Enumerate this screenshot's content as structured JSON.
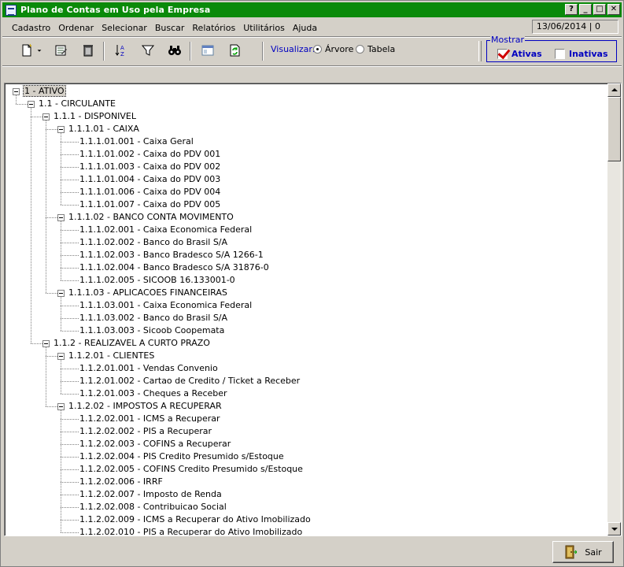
{
  "window": {
    "title": "Plano de Contas em Uso pela Empresa",
    "controls": [
      "?",
      "_",
      "□",
      "✕"
    ]
  },
  "menu": {
    "items": [
      "Cadastro",
      "Ordenar",
      "Selecionar",
      "Buscar",
      "Relatórios",
      "Utilitários",
      "Ajuda"
    ],
    "date_status": "13/06/2014 | 0"
  },
  "toolbar": {
    "tools": [
      "new-icon",
      "dropdown-arrow-icon",
      "edit-icon",
      "trash-icon",
      "sort-az-icon",
      "filter-icon",
      "binoculars-icon",
      "window-icon",
      "refresh-icon"
    ],
    "visualizar_label": "Visualizar:",
    "view_options": [
      {
        "label": "Árvore",
        "selected": true
      },
      {
        "label": "Tabela",
        "selected": false
      }
    ]
  },
  "mostrar": {
    "legend": "Mostrar",
    "ativas": {
      "label": "Ativas",
      "checked": true
    },
    "inativas": {
      "label": "Inativas",
      "checked": false
    }
  },
  "tree": [
    {
      "level": 0,
      "text": "1 - ATIVO",
      "expanded": true,
      "selected": true
    },
    {
      "level": 1,
      "text": "1.1 - CIRCULANTE",
      "expanded": true
    },
    {
      "level": 2,
      "text": "1.1.1 - DISPONIVEL",
      "expanded": true
    },
    {
      "level": 3,
      "text": "1.1.1.01 - CAIXA",
      "expanded": true
    },
    {
      "level": 4,
      "text": "1.1.1.01.001 - Caixa Geral"
    },
    {
      "level": 4,
      "text": "1.1.1.01.002 - Caixa do PDV 001"
    },
    {
      "level": 4,
      "text": "1.1.1.01.003 - Caixa do PDV 002"
    },
    {
      "level": 4,
      "text": "1.1.1.01.004 - Caixa do PDV 003"
    },
    {
      "level": 4,
      "text": "1.1.1.01.006 - Caixa do PDV 004"
    },
    {
      "level": 4,
      "text": "1.1.1.01.007 - Caixa do PDV 005"
    },
    {
      "level": 3,
      "text": "1.1.1.02 - BANCO CONTA MOVIMENTO",
      "expanded": true
    },
    {
      "level": 4,
      "text": "1.1.1.02.001 - Caixa Economica Federal"
    },
    {
      "level": 4,
      "text": "1.1.1.02.002 - Banco do Brasil S/A"
    },
    {
      "level": 4,
      "text": "1.1.1.02.003 - Banco Bradesco S/A 1266-1"
    },
    {
      "level": 4,
      "text": "1.1.1.02.004 - Banco Bradesco S/A 31876-0"
    },
    {
      "level": 4,
      "text": "1.1.1.02.005 - SICOOB 16.133001-0"
    },
    {
      "level": 3,
      "text": "1.1.1.03 - APLICACOES FINANCEIRAS",
      "expanded": true
    },
    {
      "level": 4,
      "text": "1.1.1.03.001 - Caixa Economica Federal"
    },
    {
      "level": 4,
      "text": "1.1.1.03.002 - Banco do Brasil S/A"
    },
    {
      "level": 4,
      "text": "1.1.1.03.003 - Sicoob Coopemata"
    },
    {
      "level": 2,
      "text": "1.1.2 - REALIZAVEL A CURTO PRAZO",
      "expanded": true
    },
    {
      "level": 3,
      "text": "1.1.2.01 - CLIENTES",
      "expanded": true
    },
    {
      "level": 4,
      "text": "1.1.2.01.001 - Vendas Convenio"
    },
    {
      "level": 4,
      "text": "1.1.2.01.002 - Cartao de Credito / Ticket a Receber"
    },
    {
      "level": 4,
      "text": "1.1.2.01.003 - Cheques a Receber"
    },
    {
      "level": 3,
      "text": "1.1.2.02 - IMPOSTOS A RECUPERAR",
      "expanded": true
    },
    {
      "level": 4,
      "text": "1.1.2.02.001 - ICMS a Recuperar"
    },
    {
      "level": 4,
      "text": "1.1.2.02.002 - PIS a Recuperar"
    },
    {
      "level": 4,
      "text": "1.1.2.02.003 - COFINS a Recuperar"
    },
    {
      "level": 4,
      "text": "1.1.2.02.004 - PIS Credito Presumido s/Estoque"
    },
    {
      "level": 4,
      "text": "1.1.2.02.005 - COFINS Credito Presumido s/Estoque"
    },
    {
      "level": 4,
      "text": "1.1.2.02.006 - IRRF"
    },
    {
      "level": 4,
      "text": "1.1.2.02.007 - Imposto de Renda"
    },
    {
      "level": 4,
      "text": "1.1.2.02.008 - Contribuicao Social"
    },
    {
      "level": 4,
      "text": "1.1.2.02.009 - ICMS a Recuperar do Ativo Imobilizado"
    },
    {
      "level": 4,
      "text": "1.1.2.02.010 - PIS a Recuperar do Ativo Imobilizado"
    }
  ],
  "footer": {
    "sair_label": "Sair"
  }
}
